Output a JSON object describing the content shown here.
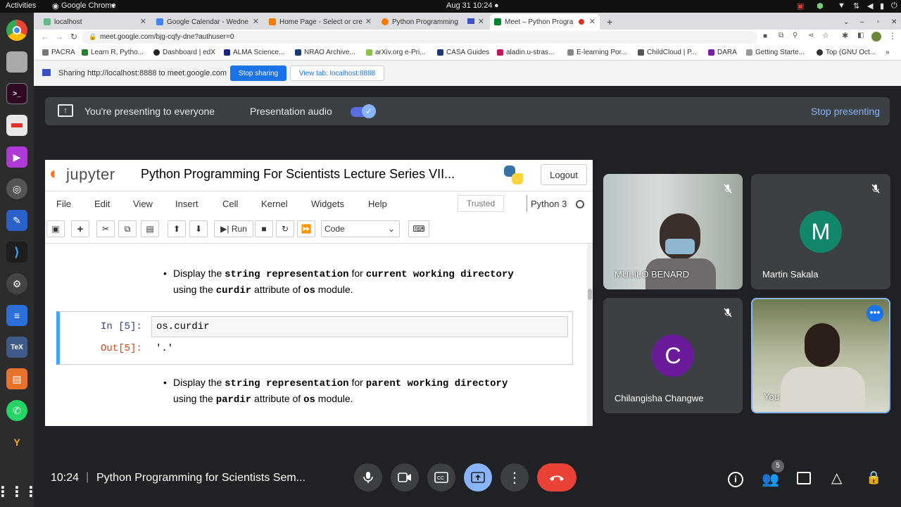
{
  "topbar": {
    "activities": "Activities",
    "app": "Google Chrome",
    "clock": "Aug 31  10:24"
  },
  "tabs": [
    {
      "label": "localhost"
    },
    {
      "label": "Google Calendar - Wedne"
    },
    {
      "label": "Home Page - Select or cre"
    },
    {
      "label": "Python Programming"
    },
    {
      "label": "Meet – Python Progra"
    }
  ],
  "address": {
    "url": "meet.google.com/bjg-cqfy-dne?authuser=0"
  },
  "bookmarks": [
    "PACRA",
    "Learn R, Pytho...",
    "Dashboard | edX",
    "ALMA Science...",
    "NRAO Archive...",
    "arXiv.org e-Pri...",
    "CASA Guides",
    "aladin.u-stras...",
    "E-learning Por...",
    "ChildCloud | P...",
    "DARA",
    "Getting Starte...",
    "Top (GNU Oct..."
  ],
  "sharebar": {
    "text": "Sharing http://localhost:8888 to meet.google.com",
    "stop": "Stop sharing",
    "view": "View tab: localhost:8888"
  },
  "presenting": {
    "text": "You're presenting to everyone",
    "audio": "Presentation audio",
    "stop": "Stop presenting"
  },
  "jupyter": {
    "logo": "jupyter",
    "title": "Python Programming For Scientists Lecture Series VII...",
    "logout": "Logout",
    "menu": [
      "File",
      "Edit",
      "View",
      "Insert",
      "Cell",
      "Kernel",
      "Widgets",
      "Help"
    ],
    "trusted": "Trusted",
    "kernel": "Python 3",
    "run": "Run",
    "celltype": "Code",
    "md1": {
      "a": "Display the",
      "b": "string representation",
      "c": "for",
      "d": "current working directory",
      "e": "using the",
      "f": "curdir",
      "g": "attribute of",
      "h": "os",
      "i": "module."
    },
    "cell": {
      "in_prompt": "In [5]:",
      "code": "os.curdir",
      "out_prompt": "Out[5]:",
      "out": "'.'"
    },
    "md2": {
      "a": "Display the",
      "b": "string representation",
      "c": "for",
      "d": "parent working directory",
      "e": "using the",
      "f": "pardir",
      "g": "attribute of",
      "h": "os",
      "i": "module."
    }
  },
  "participants": [
    {
      "name": "MULILO BENARD"
    },
    {
      "name": "Martin Sakala",
      "initial": "M",
      "color": "#12866a"
    },
    {
      "name": "Chilangisha Changwe",
      "initial": "C",
      "color": "#6a1b9a"
    },
    {
      "name": "You"
    }
  ],
  "meeting": {
    "time": "10:24",
    "divider": "|",
    "name": "Python Programming for Scientists Sem...",
    "people_count": "5"
  },
  "colors": {
    "accent": "#8ab4f8",
    "hangup": "#ea4335",
    "share_btn": "#1a73e8"
  }
}
